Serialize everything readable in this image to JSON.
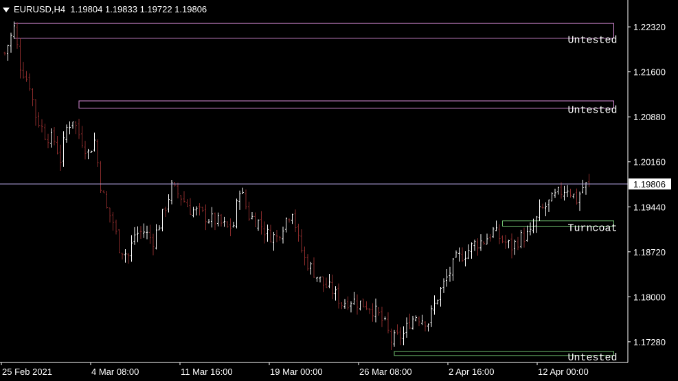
{
  "header": {
    "symbol_tf": "EURUSD,H4",
    "ohlc": "1.19804 1.19833 1.19722 1.19806"
  },
  "colors": {
    "background": "#000000",
    "axis": "#ffffff",
    "bull_candle": "#ffffff",
    "bear_candle": "#8a2b2b",
    "resistance_zone": "#d68ad6",
    "support_zone": "#6fbf6f",
    "price_line": "#b6a6e6"
  },
  "chart_data": {
    "type": "candlestick",
    "symbol": "EURUSD",
    "timeframe": "H4",
    "y_ticks": [
      1.2232,
      1.216,
      1.2088,
      1.2016,
      1.1944,
      1.1872,
      1.18,
      1.1728
    ],
    "y_tick_labels": [
      "1.22320",
      "1.21600",
      "1.20880",
      "1.20160",
      "1.19440",
      "1.18720",
      "1.18000",
      "1.17280"
    ],
    "ylim": [
      1.1696,
      1.2253
    ],
    "x_tick_labels": [
      "25 Feb 2021",
      "4 Mar 08:00",
      "11 Mar 16:00",
      "19 Mar 00:00",
      "26 Mar 08:00",
      "2 Apr 16:00",
      "12 Apr 00:00"
    ],
    "bar_count": 190,
    "current_price": 1.19806,
    "current_price_label": "1.19806",
    "close_path": [
      [
        0,
        1.219
      ],
      [
        3,
        1.223
      ],
      [
        5,
        1.217
      ],
      [
        8,
        1.214
      ],
      [
        10,
        1.209
      ],
      [
        13,
        1.206
      ],
      [
        16,
        1.205
      ],
      [
        18,
        1.202
      ],
      [
        20,
        1.207
      ],
      [
        22,
        1.2085
      ],
      [
        24,
        1.206
      ],
      [
        27,
        1.203
      ],
      [
        29,
        1.205
      ],
      [
        31,
        1.198
      ],
      [
        33,
        1.194
      ],
      [
        35,
        1.192
      ],
      [
        37,
        1.188
      ],
      [
        40,
        1.1865
      ],
      [
        42,
        1.19
      ],
      [
        45,
        1.1905
      ],
      [
        48,
        1.189
      ],
      [
        51,
        1.193
      ],
      [
        54,
        1.1975
      ],
      [
        57,
        1.196
      ],
      [
        60,
        1.194
      ],
      [
        63,
        1.1935
      ],
      [
        66,
        1.1925
      ],
      [
        69,
        1.192
      ],
      [
        72,
        1.191
      ],
      [
        74,
        1.1915
      ],
      [
        76,
        1.1975
      ],
      [
        79,
        1.193
      ],
      [
        82,
        1.192
      ],
      [
        85,
        1.19
      ],
      [
        88,
        1.1895
      ],
      [
        91,
        1.1925
      ],
      [
        93,
        1.194
      ],
      [
        95,
        1.189
      ],
      [
        97,
        1.186
      ],
      [
        100,
        1.184
      ],
      [
        103,
        1.182
      ],
      [
        106,
        1.181
      ],
      [
        109,
        1.179
      ],
      [
        112,
        1.1795
      ],
      [
        115,
        1.179
      ],
      [
        118,
        1.1785
      ],
      [
        121,
        1.177
      ],
      [
        123,
        1.1755
      ],
      [
        125,
        1.173
      ],
      [
        127,
        1.1735
      ],
      [
        129,
        1.174
      ],
      [
        131,
        1.176
      ],
      [
        133,
        1.177
      ],
      [
        135,
        1.1765
      ],
      [
        137,
        1.176
      ],
      [
        140,
        1.18
      ],
      [
        143,
        1.183
      ],
      [
        146,
        1.186
      ],
      [
        149,
        1.187
      ],
      [
        152,
        1.1885
      ],
      [
        155,
        1.189
      ],
      [
        158,
        1.1905
      ],
      [
        161,
        1.189
      ],
      [
        164,
        1.188
      ],
      [
        167,
        1.1895
      ],
      [
        170,
        1.19
      ],
      [
        173,
        1.1935
      ],
      [
        176,
        1.195
      ],
      [
        179,
        1.1965
      ],
      [
        182,
        1.1975
      ],
      [
        185,
        1.1955
      ],
      [
        187,
        1.1975
      ],
      [
        189,
        1.1981
      ]
    ],
    "zones": [
      {
        "name": "supply-zone-1",
        "top": 1.22375,
        "bottom": 1.2214,
        "start_bar": 3,
        "label": "Untested",
        "kind": "resistance"
      },
      {
        "name": "supply-zone-2",
        "top": 1.21135,
        "bottom": 1.2102,
        "start_bar": 24,
        "label": "Untested",
        "kind": "resistance"
      },
      {
        "name": "turncoat-zone",
        "top": 1.19215,
        "bottom": 1.1913,
        "start_bar": 161,
        "label": "Turncoat",
        "kind": "support"
      },
      {
        "name": "demand-zone-1",
        "top": 1.17125,
        "bottom": 1.1706,
        "start_bar": 126,
        "label": "Untested",
        "kind": "support"
      }
    ],
    "zone_end_bar": 197
  }
}
